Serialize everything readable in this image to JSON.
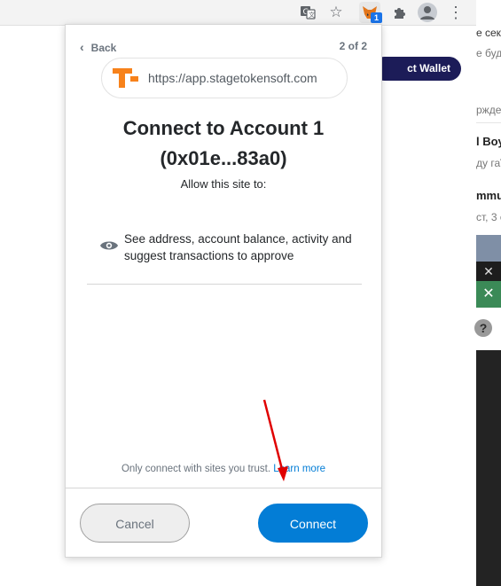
{
  "background_page": {
    "lines": [
      "е сект",
      "е буд",
      "ржден",
      "l Boy",
      "ду гаї",
      "mmu",
      "ст, 3 с"
    ],
    "connect_wallet_label": "ct Wallet"
  },
  "toolbar": {
    "extension_badge": "1",
    "icons": [
      "translate-icon",
      "star-icon",
      "metamask-fox-icon",
      "puzzle-icon",
      "profile-icon",
      "kebab-menu-icon"
    ]
  },
  "popup": {
    "back_label": "Back",
    "step_indicator": "2 of 2",
    "site_url": "https://app.stagetokensoft.com",
    "title_line1": "Connect to Account 1",
    "title_line2": "(0x01e...83a0)",
    "allow_text": "Allow this site to:",
    "permission_text": "See address, account balance, activity and suggest transactions to approve",
    "trust_text": "Only connect with sites you trust.",
    "learn_more_label": "Learn more",
    "cancel_label": "Cancel",
    "connect_label": "Connect"
  },
  "colors": {
    "accent": "#037dd6",
    "logo": "#f7821b",
    "annotation_arrow": "#e00000"
  }
}
